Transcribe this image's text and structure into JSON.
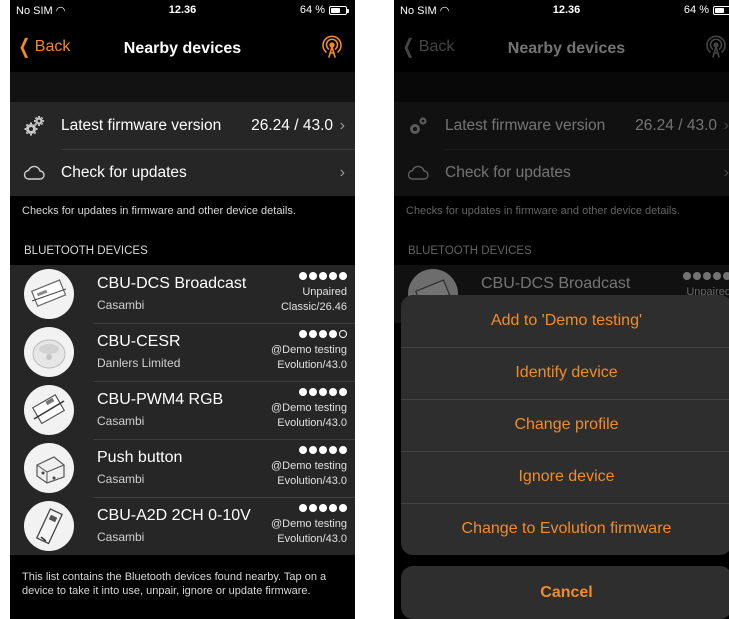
{
  "status_bar": {
    "carrier": "No SIM",
    "time": "12.36",
    "battery": "64 %",
    "battery_level": 0.64
  },
  "nav": {
    "back_label": "Back",
    "title": "Nearby devices",
    "right_icon": "radar-broadcast-icon"
  },
  "settings": {
    "firmware": {
      "label": "Latest firmware version",
      "value": "26.24 / 43.0",
      "icon": "gears-icon"
    },
    "updates": {
      "label": "Check for updates",
      "icon": "cloud-icon"
    },
    "note": "Checks for updates in firmware and other device details."
  },
  "bluetooth": {
    "header": "BLUETOOTH DEVICES",
    "devices": [
      {
        "name": "CBU-DCS Broadcast",
        "maker": "Casambi",
        "status": "Unpaired",
        "firmware": "Classic/26.46",
        "signal": 5
      },
      {
        "name": "CBU-CESR",
        "maker": "Danlers Limited",
        "status": "@Demo testing",
        "firmware": "Evolution/43.0",
        "signal": 4
      },
      {
        "name": "CBU-PWM4 RGB",
        "maker": "Casambi",
        "status": "@Demo testing",
        "firmware": "Evolution/43.0",
        "signal": 5
      },
      {
        "name": "Push button",
        "maker": "Casambi",
        "status": "@Demo testing",
        "firmware": "Evolution/43.0",
        "signal": 5
      },
      {
        "name": "CBU-A2D 2CH 0-10V",
        "maker": "Casambi",
        "status": "@Demo testing",
        "firmware": "Evolution/43.0",
        "signal": 5
      }
    ],
    "footer": "This list contains the Bluetooth devices found nearby. Tap on a device to take it into use, unpair, ignore or update firmware."
  },
  "action_sheet": {
    "items": [
      "Add to 'Demo testing'",
      "Identify device",
      "Change profile",
      "Ignore device",
      "Change to Evolution firmware"
    ],
    "cancel": "Cancel"
  },
  "colors": {
    "accent": "#f08c2a",
    "background": "#000000",
    "cell": "#262626",
    "sheet": "#2e2e2e"
  }
}
